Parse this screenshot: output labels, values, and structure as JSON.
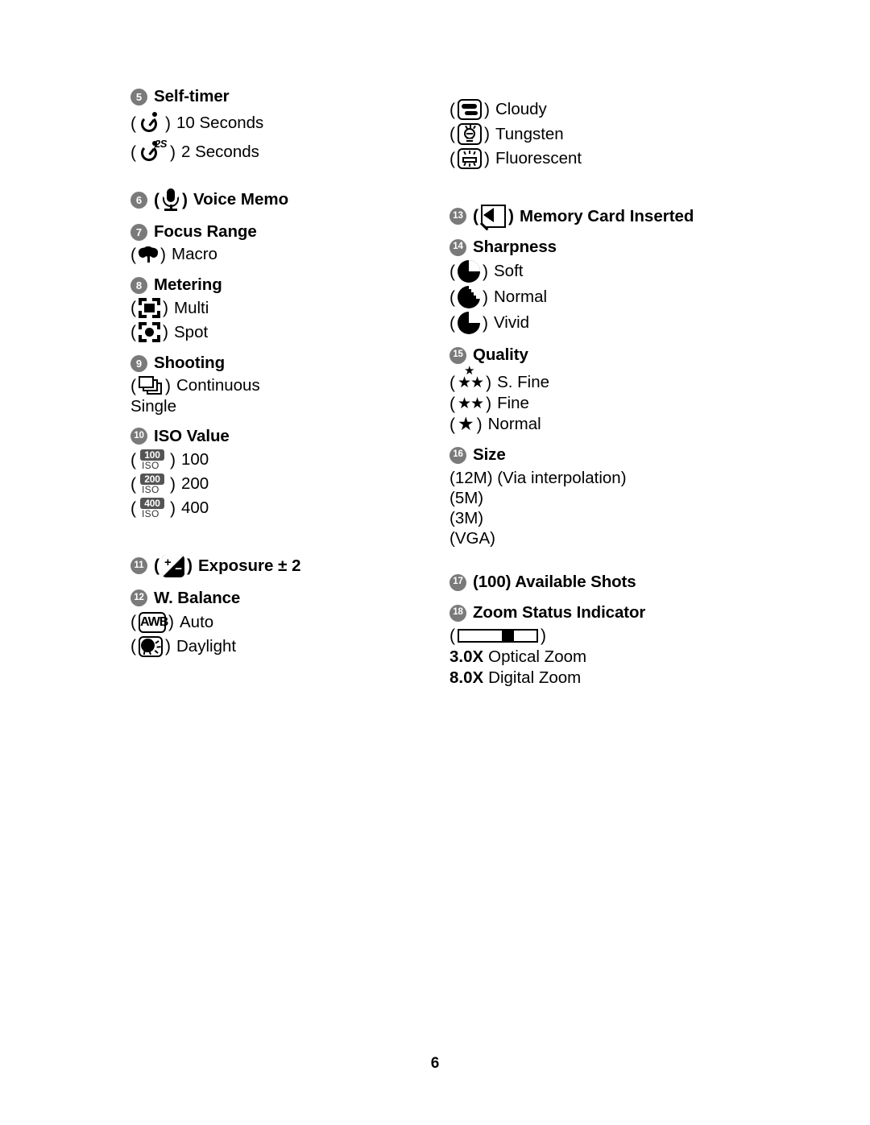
{
  "page": {
    "number": "6"
  },
  "left_column": {
    "self_timer": {
      "num": "5",
      "title": "Self-timer",
      "options": [
        {
          "icon": "self-timer-10s-icon",
          "label": "10 Seconds"
        },
        {
          "icon": "self-timer-2s-icon",
          "label": "2 Seconds",
          "badge_text": "2S"
        }
      ]
    },
    "voice_memo": {
      "num": "6",
      "title": "Voice Memo",
      "icon": "microphone-icon"
    },
    "focus_range": {
      "num": "7",
      "title": "Focus Range",
      "options": [
        {
          "icon": "macro-flower-icon",
          "label": "Macro"
        }
      ]
    },
    "metering": {
      "num": "8",
      "title": "Metering",
      "options": [
        {
          "icon": "metering-multi-icon",
          "label": "Multi"
        },
        {
          "icon": "metering-spot-icon",
          "label": "Spot"
        }
      ]
    },
    "shooting": {
      "num": "9",
      "title": "Shooting",
      "options": [
        {
          "icon": "continuous-shooting-icon",
          "label": "Continuous"
        }
      ],
      "plain_option": "Single"
    },
    "iso_value": {
      "num": "10",
      "title": "ISO Value",
      "options": [
        {
          "icon": "iso-100-icon",
          "icon_number": "100",
          "icon_text": "ISO",
          "label": "100"
        },
        {
          "icon": "iso-200-icon",
          "icon_number": "200",
          "icon_text": "ISO",
          "label": "200"
        },
        {
          "icon": "iso-400-icon",
          "icon_number": "400",
          "icon_text": "ISO",
          "label": "400"
        }
      ]
    },
    "exposure": {
      "num": "11",
      "title": "Exposure ± 2",
      "icon": "exposure-compensation-icon",
      "icon_plus": "+",
      "icon_minus": "−"
    },
    "w_balance": {
      "num": "12",
      "title": "W. Balance",
      "options": [
        {
          "icon": "awb-icon",
          "icon_text": "AWB",
          "label": "Auto"
        },
        {
          "icon": "daylight-icon",
          "label": "Daylight"
        }
      ]
    }
  },
  "right_column": {
    "w_balance_cont": {
      "options": [
        {
          "icon": "cloudy-icon",
          "label": "Cloudy"
        },
        {
          "icon": "tungsten-icon",
          "label": "Tungsten"
        },
        {
          "icon": "fluorescent-icon",
          "label": "Fluorescent"
        }
      ]
    },
    "memory_card": {
      "num": "13",
      "title": "Memory Card Inserted",
      "icon": "memory-card-icon"
    },
    "sharpness": {
      "num": "14",
      "title": "Sharpness",
      "options": [
        {
          "icon": "sharpness-soft-icon",
          "label": "Soft"
        },
        {
          "icon": "sharpness-normal-icon",
          "label": "Normal"
        },
        {
          "icon": "sharpness-vivid-icon",
          "label": "Vivid"
        }
      ]
    },
    "quality": {
      "num": "15",
      "title": "Quality",
      "options": [
        {
          "icon": "three-stars-icon",
          "stars": "★★",
          "star_top": "★",
          "label": "S. Fine"
        },
        {
          "icon": "two-stars-icon",
          "stars": "★★",
          "label": "Fine"
        },
        {
          "icon": "one-star-icon",
          "stars": "★",
          "label": "Normal"
        }
      ]
    },
    "size": {
      "num": "16",
      "title": "Size",
      "options": [
        "(12M) (Via interpolation)",
        "(5M)",
        "(3M)",
        "(VGA)"
      ]
    },
    "available_shots": {
      "num": "17",
      "title": "(100) Available Shots"
    },
    "zoom_status": {
      "num": "18",
      "title": "Zoom Status Indicator",
      "icon": "zoom-status-bar-icon",
      "optical": {
        "value": "3.0X",
        "label": "Optical Zoom"
      },
      "digital": {
        "value": "8.0X",
        "label": "Digital Zoom"
      }
    }
  }
}
